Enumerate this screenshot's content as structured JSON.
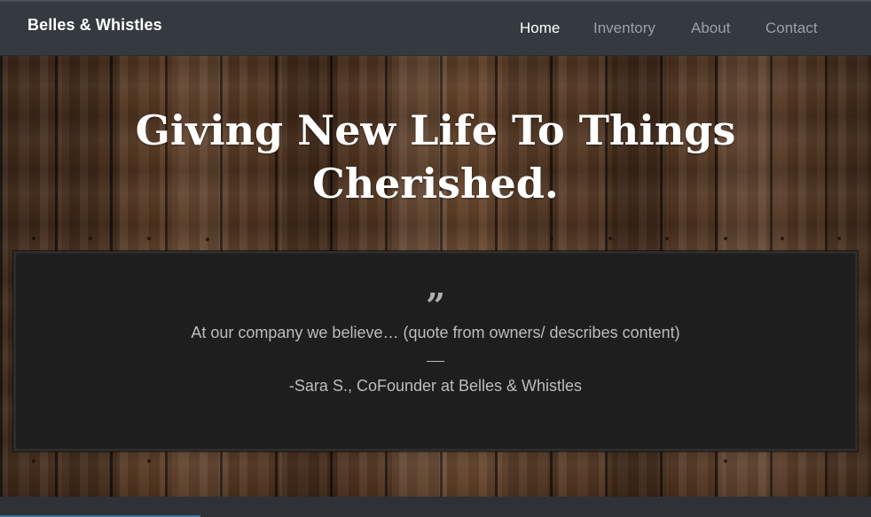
{
  "navbar": {
    "brand": "Belles & Whistles",
    "links": [
      {
        "label": "Home",
        "active": true
      },
      {
        "label": "Inventory",
        "active": false
      },
      {
        "label": "About",
        "active": false
      },
      {
        "label": "Contact",
        "active": false
      }
    ]
  },
  "hero": {
    "headline_line1": "Giving New Life To Things",
    "headline_line2": "Cherished.",
    "background": "dark wood planks"
  },
  "testimonial": {
    "quote_icon": "quote-icon",
    "quote": "At our company we believe… (quote from owners/ describes content)",
    "author": "-Sara S., CoFounder at Belles & Whistles"
  },
  "colors": {
    "navbar_bg": "#343a40",
    "nav_active": "#ffffff",
    "nav_inactive": "#9aa0a6",
    "quote_box_bg": "#1e1e1e",
    "quote_text": "#bdbdbd"
  }
}
